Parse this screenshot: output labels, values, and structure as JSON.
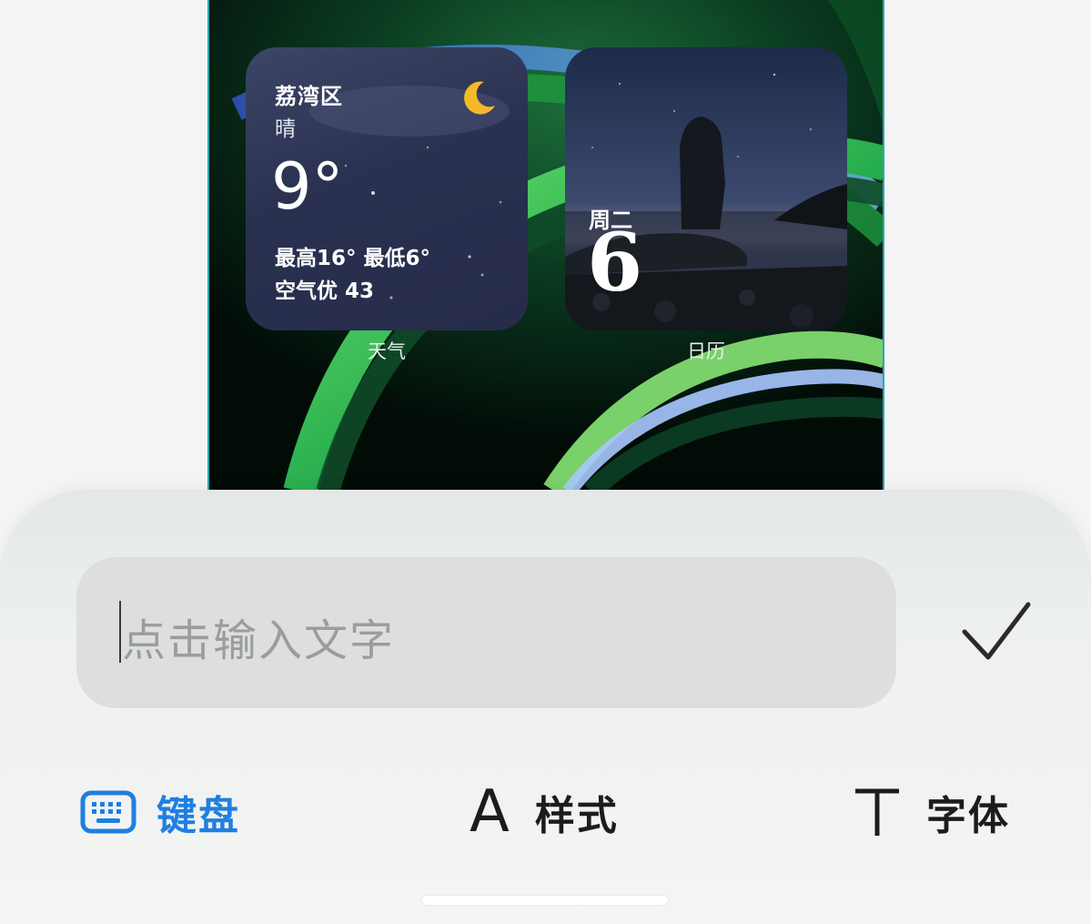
{
  "weather_widget": {
    "location": "荔湾区",
    "condition": "晴",
    "temperature": "9°",
    "range": "最高16° 最低6°",
    "air_quality": "空气优 43",
    "label": "天气",
    "icon": "crescent-moon-icon"
  },
  "calendar_widget": {
    "weekday": "周二",
    "day": "6",
    "label": "日历"
  },
  "text_input": {
    "placeholder": "点击输入文字",
    "value": ""
  },
  "toolbar": {
    "keyboard_label": "键盘",
    "style_glyph": "A",
    "style_label": "样式",
    "font_label": "字体"
  },
  "icons": {
    "keyboard": "keyboard-icon",
    "confirm": "checkmark-icon",
    "font": "text-t-icon"
  },
  "colors": {
    "accent": "#1f7fe0",
    "text_primary": "#1c1c1c",
    "placeholder": "#9b9d9c"
  }
}
